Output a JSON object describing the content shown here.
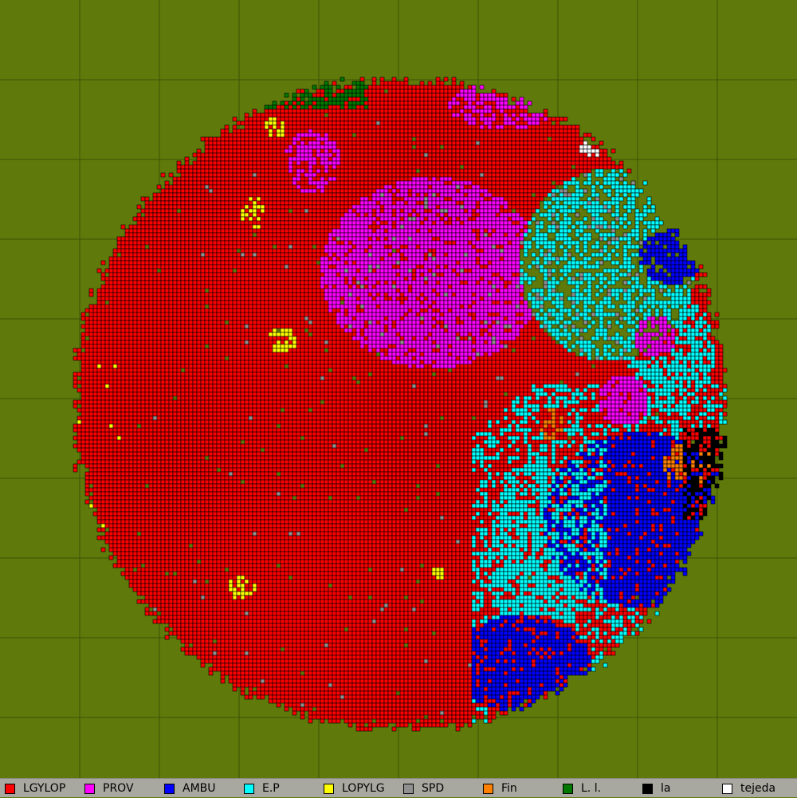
{
  "colors": {
    "background": "#5f7a0a",
    "grid_line": "#3c5207",
    "cell_border": "#000000"
  },
  "factions": [
    {
      "id": "lgylop",
      "label": "LGYLOP",
      "color": "#ff0000"
    },
    {
      "id": "prov",
      "label": "PROV",
      "color": "#ff00ff"
    },
    {
      "id": "ambu",
      "label": "AMBU",
      "color": "#0000ff"
    },
    {
      "id": "ep",
      "label": "E.P",
      "color": "#00ffff"
    },
    {
      "id": "lopylg",
      "label": "LOPYLG",
      "color": "#ffff00"
    },
    {
      "id": "spd",
      "label": "SPD",
      "color": "#909090"
    },
    {
      "id": "fin",
      "label": "Fin",
      "color": "#ff8000"
    },
    {
      "id": "ll",
      "label": "L. l.",
      "color": "#007800"
    },
    {
      "id": "la",
      "label": "la",
      "color": "#000000"
    },
    {
      "id": "tejeda",
      "label": "tejeda",
      "color": "#ffffff"
    }
  ]
}
